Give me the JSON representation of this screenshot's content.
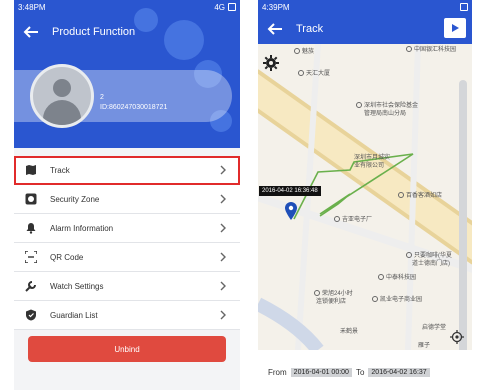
{
  "left": {
    "status": {
      "time": "3:48PM",
      "network": "4G"
    },
    "title": "Product Function",
    "device": {
      "number": "2",
      "id_text": "ID:860247030018721"
    },
    "menu": [
      {
        "label": "Track",
        "icon": "map-icon"
      },
      {
        "label": "Security Zone",
        "icon": "circle-icon"
      },
      {
        "label": "Alarm Information",
        "icon": "bell-icon"
      },
      {
        "label": "QR Code",
        "icon": "qr-icon"
      },
      {
        "label": "Watch Settings",
        "icon": "wrench-icon"
      },
      {
        "label": "Guardian List",
        "icon": "shield-icon"
      }
    ],
    "unbind_label": "Unbind",
    "colors": {
      "header": "#2a56d0",
      "unbind": "#e04a3f",
      "highlight": "#e12b2b"
    }
  },
  "right": {
    "status": {
      "time": "4:39PM"
    },
    "title": "Track",
    "map_labels": [
      "魅族",
      "中国银汇科技园",
      "天汇大厦",
      "深圳市社会保险基金",
      "管理局南山分局",
      "深圳市月城实",
      "业有限公司",
      "百香客酒如店",
      "吉亚电子厂",
      "只要咖啡(华夏",
      "道士德南门店)",
      "中泰科技园",
      "荣旭24小时",
      "连锁便利店",
      "凯业电子商业园",
      "禾鹤景",
      "启德学堂",
      "雁子"
    ],
    "tooltip": "2016-04-02 16:36:48",
    "footer": {
      "from_label": "From",
      "from_value": "2016-04-01 00:00",
      "to_label": "To",
      "to_value": "2016-04-02 16:37"
    }
  }
}
